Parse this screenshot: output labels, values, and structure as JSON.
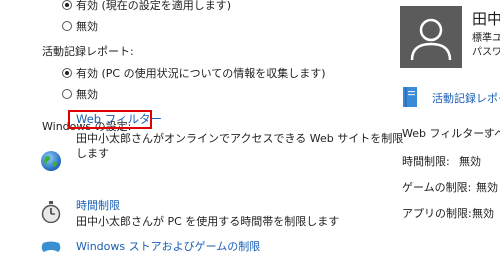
{
  "settings": {
    "option1_partial": "有効 (現在の設定を適用します)",
    "option1_off": "無効",
    "activity_heading": "活動記録レポート:",
    "activity_on": "有効 (PC の使用状況についての情報を収集します)",
    "activity_off": "無効",
    "windows_heading": "Windows の設定:",
    "web_filter": {
      "title": "Web フィルター",
      "desc_line1": "田中小太郎さんがオンラインでアクセスできる Web サイトを制限",
      "desc_line2": "します"
    },
    "time_limits": {
      "title": "時間制限",
      "desc": "田中小太郎さんが PC を使用する時間帯を制限します"
    },
    "store_games": {
      "title": "Windows ストアおよびゲームの制限"
    }
  },
  "profile": {
    "name": "田中",
    "account_type": "標準ユ",
    "password": "パスワ"
  },
  "right_panel": {
    "activity_report_link": "活動記録レポー",
    "rows": [
      {
        "label": "Web フィルター:",
        "value": "すべ"
      },
      {
        "label": "時間制限:",
        "value": "無効"
      },
      {
        "label": "ゲームの制限:",
        "value": "無効"
      },
      {
        "label": "アプリの制限:",
        "value": "無効"
      }
    ]
  },
  "colors": {
    "link": "#1a5fb4",
    "highlight": "#e00000"
  }
}
